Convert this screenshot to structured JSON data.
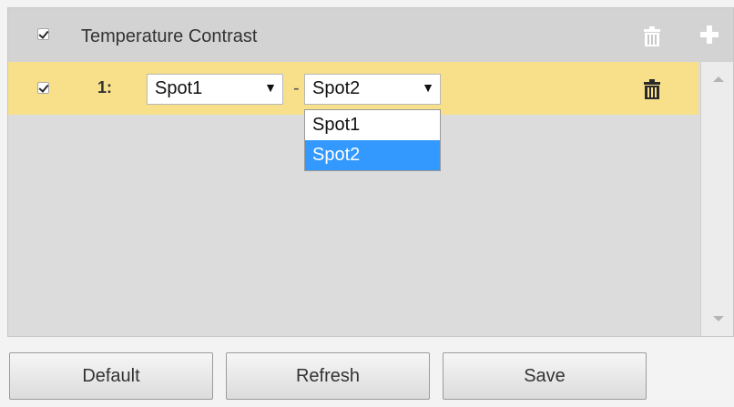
{
  "header": {
    "title": "Temperature Contrast",
    "checked": true
  },
  "rows": [
    {
      "checked": true,
      "number": "1:",
      "first_select": {
        "value": "Spot1"
      },
      "separator": "-",
      "second_select": {
        "value": "Spot2"
      }
    }
  ],
  "dropdown": {
    "options": [
      "Spot1",
      "Spot2"
    ],
    "selected": "Spot2"
  },
  "icons": {
    "dropdown_arrow": "▼"
  },
  "buttons": {
    "default": "Default",
    "refresh": "Refresh",
    "save": "Save"
  },
  "colors": {
    "row_highlight": "#f8e08a",
    "selected_option": "#3399ff"
  }
}
